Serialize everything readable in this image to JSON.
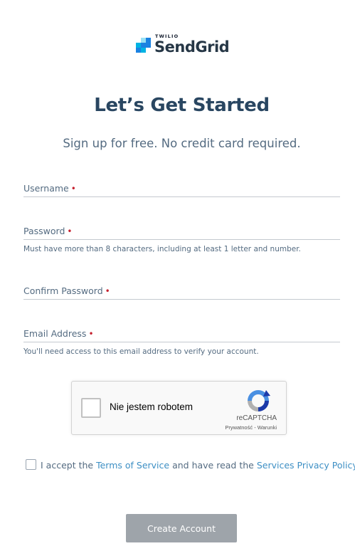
{
  "brand": {
    "twilio": "TWILIO",
    "name": "SendGrid",
    "colors": {
      "dark_blue": "#263746",
      "blue": "#1a82e2",
      "light_blue": "#00b3e3",
      "lightest_blue": "#99e1f4"
    }
  },
  "header": {
    "title": "Let’s Get Started",
    "subtitle": "Sign up for free. No credit card required."
  },
  "form": {
    "username": {
      "label": "Username",
      "required_mark": "•"
    },
    "password": {
      "label": "Password",
      "required_mark": "•",
      "help": "Must have more than 8 characters, including at least 1 letter and number."
    },
    "confirm_password": {
      "label": "Confirm Password",
      "required_mark": "•"
    },
    "email": {
      "label": "Email Address",
      "required_mark": "•",
      "help": "You'll need access to this email address to verify your account."
    }
  },
  "recaptcha": {
    "label": "Nie jestem robotem",
    "brand": "reCAPTCHA",
    "links": "Prywatność - Warunki"
  },
  "terms": {
    "prefix": "I accept the",
    "tos_link": "Terms of Service",
    "middle": "and have read the",
    "privacy_link": "Services Privacy Policy"
  },
  "submit": {
    "label": "Create Account"
  },
  "colors": {
    "heading": "#294661",
    "required": "#c5202e",
    "link": "#3d8fc4",
    "button_disabled": "#9ea4aa"
  }
}
